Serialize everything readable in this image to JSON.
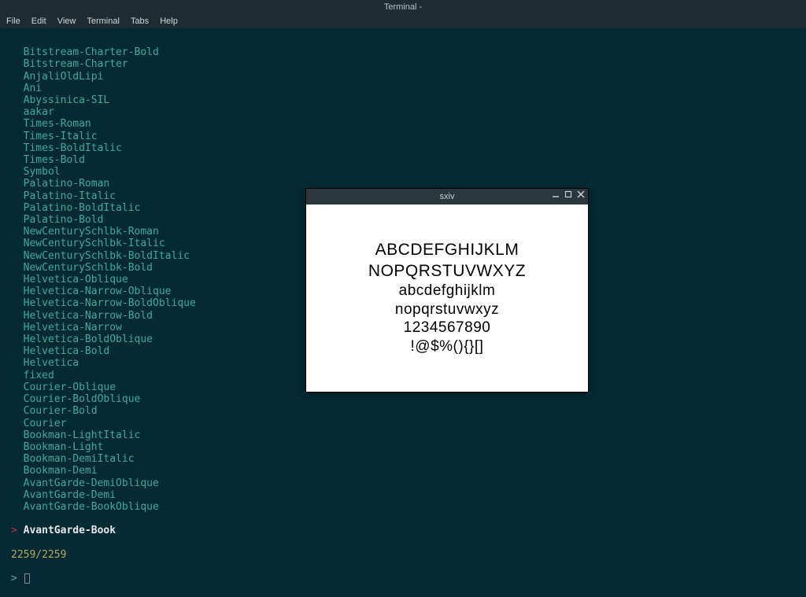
{
  "window": {
    "title": "Terminal -"
  },
  "menu": {
    "file": "File",
    "edit": "Edit",
    "view": "View",
    "terminal": "Terminal",
    "tabs": "Tabs",
    "help": "Help"
  },
  "fonts": [
    "Bitstream-Charter-Bold",
    "Bitstream-Charter",
    "AnjaliOldLipi",
    "Ani",
    "Abyssinica-SIL",
    "aakar",
    "Times-Roman",
    "Times-Italic",
    "Times-BoldItalic",
    "Times-Bold",
    "Symbol",
    "Palatino-Roman",
    "Palatino-Italic",
    "Palatino-BoldItalic",
    "Palatino-Bold",
    "NewCenturySchlbk-Roman",
    "NewCenturySchlbk-Italic",
    "NewCenturySchlbk-BoldItalic",
    "NewCenturySchlbk-Bold",
    "Helvetica-Oblique",
    "Helvetica-Narrow-Oblique",
    "Helvetica-Narrow-BoldOblique",
    "Helvetica-Narrow-Bold",
    "Helvetica-Narrow",
    "Helvetica-BoldOblique",
    "Helvetica-Bold",
    "Helvetica",
    "fixed",
    "Courier-Oblique",
    "Courier-BoldOblique",
    "Courier-Bold",
    "Courier",
    "Bookman-LightItalic",
    "Bookman-Light",
    "Bookman-DemiItalic",
    "Bookman-Demi",
    "AvantGarde-DemiOblique",
    "AvantGarde-Demi",
    "AvantGarde-BookOblique"
  ],
  "selected": {
    "marker": ">",
    "name": "AvantGarde-Book"
  },
  "status": "2259/2259",
  "prompt": ">",
  "sxiv": {
    "title": "sxiv",
    "line1": "ABCDEFGHIJKLM",
    "line2": "NOPQRSTUVWXYZ",
    "line3": "abcdefghijklm",
    "line4": "nopqrstuvwxyz",
    "line5": "1234567890",
    "line6": "!@$%(){}[]"
  }
}
